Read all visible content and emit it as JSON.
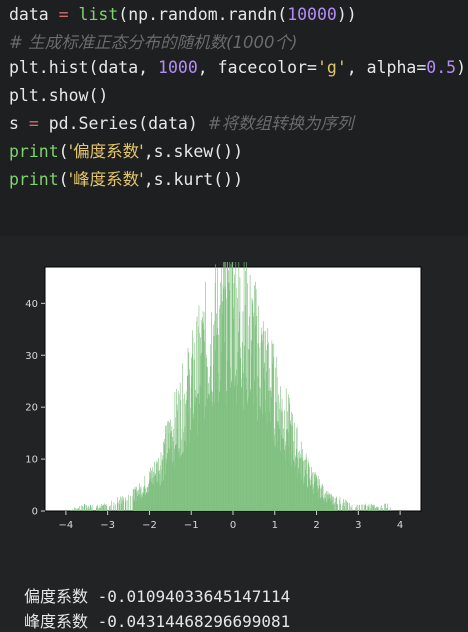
{
  "code": {
    "line1": {
      "a": "data ",
      "b": "=",
      "c": " ",
      "d": "list",
      "e": "(np.random.randn(",
      "f": "10000",
      "g": "))"
    },
    "line2": {
      "comment": "# 生成标准正态分布的随机数(1000个)"
    },
    "line3": {
      "a": "plt.hist(data, ",
      "b": "1000",
      "c": ", facecolor=",
      "d": "'g'",
      "e": ", alpha=",
      "f": "0.5",
      "g": ")"
    },
    "line4": {
      "a": "plt.show()"
    },
    "line5": {
      "a": "s ",
      "b": "=",
      "c": " pd.Series(data) ",
      "d": "#将数组转换为序列"
    },
    "line6": {
      "a": "print",
      "b": "(",
      "c": "'偏度系数'",
      "d": ",s.skew())"
    },
    "line7": {
      "a": "print",
      "b": "(",
      "c": "'峰度系数'",
      "d": ",s.kurt())"
    }
  },
  "chart_data": {
    "type": "bar",
    "x_range": [
      -4.5,
      4.5
    ],
    "y_range": [
      0,
      47
    ],
    "x_ticks": [
      -4,
      -3,
      -2,
      -1,
      0,
      1,
      2,
      3,
      4
    ],
    "y_ticks": [
      0,
      10,
      20,
      30,
      40
    ],
    "bar_color": "#7fbf7f",
    "bins": 1000,
    "values_per_0_1_step": [
      {
        "x": -4.0,
        "y": 0
      },
      {
        "x": -3.6,
        "y": 1
      },
      {
        "x": -3.2,
        "y": 1
      },
      {
        "x": -3.0,
        "y": 1
      },
      {
        "x": -2.8,
        "y": 2
      },
      {
        "x": -2.6,
        "y": 2
      },
      {
        "x": -2.4,
        "y": 3
      },
      {
        "x": -2.2,
        "y": 4
      },
      {
        "x": -2.0,
        "y": 6
      },
      {
        "x": -1.8,
        "y": 8
      },
      {
        "x": -1.6,
        "y": 12
      },
      {
        "x": -1.4,
        "y": 16
      },
      {
        "x": -1.2,
        "y": 20
      },
      {
        "x": -1.0,
        "y": 24
      },
      {
        "x": -0.8,
        "y": 28
      },
      {
        "x": -0.6,
        "y": 32
      },
      {
        "x": -0.4,
        "y": 34
      },
      {
        "x": -0.2,
        "y": 36
      },
      {
        "x": 0.0,
        "y": 38
      },
      {
        "x": 0.2,
        "y": 36
      },
      {
        "x": 0.4,
        "y": 33
      },
      {
        "x": 0.6,
        "y": 30
      },
      {
        "x": 0.8,
        "y": 26
      },
      {
        "x": 1.0,
        "y": 22
      },
      {
        "x": 1.2,
        "y": 18
      },
      {
        "x": 1.4,
        "y": 14
      },
      {
        "x": 1.6,
        "y": 10
      },
      {
        "x": 1.8,
        "y": 7
      },
      {
        "x": 2.0,
        "y": 5
      },
      {
        "x": 2.2,
        "y": 3
      },
      {
        "x": 2.4,
        "y": 2
      },
      {
        "x": 2.6,
        "y": 2
      },
      {
        "x": 2.8,
        "y": 1
      },
      {
        "x": 3.0,
        "y": 1
      },
      {
        "x": 3.4,
        "y": 1
      },
      {
        "x": 3.8,
        "y": 1
      }
    ],
    "peak_value": 44
  },
  "results": [
    {
      "label": "偏度系数",
      "value": " -0.01094033645147114"
    },
    {
      "label": "峰度系数",
      "value": " -0.04314468296699081"
    }
  ]
}
